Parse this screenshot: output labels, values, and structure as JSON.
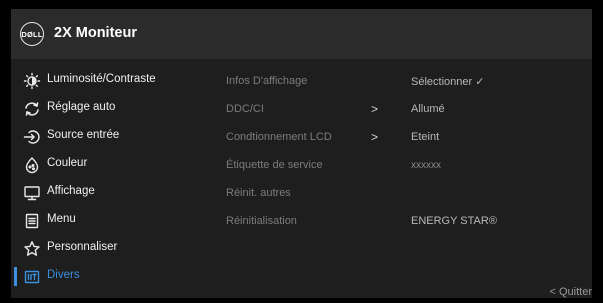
{
  "header": {
    "logo_text": "DØLL",
    "title": "2X Moniteur"
  },
  "sidebar": {
    "items": [
      {
        "label": "Luminosité/Contraste",
        "icon": "brightness-icon"
      },
      {
        "label": "Réglage auto",
        "icon": "auto-adjust-icon"
      },
      {
        "label": "Source entrée",
        "icon": "input-source-icon"
      },
      {
        "label": "Couleur",
        "icon": "color-palette-icon"
      },
      {
        "label": "Affichage",
        "icon": "display-icon"
      },
      {
        "label": "Menu",
        "icon": "menu-icon"
      },
      {
        "label": "Personnaliser",
        "icon": "star-icon"
      },
      {
        "label": "Divers",
        "icon": "others-icon"
      }
    ],
    "active_index": 7
  },
  "submenu": {
    "items": [
      {
        "label": "Infos D'affichage",
        "arrow": "",
        "value": "Sélectionner ✓"
      },
      {
        "label": "DDC/CI",
        "arrow": ">",
        "value": "Allumé"
      },
      {
        "label": "Condtionnement LCD",
        "arrow": ">",
        "value": "Eteint"
      },
      {
        "label": "Étiquette de service",
        "arrow": "",
        "value": "xxxxxx"
      },
      {
        "label": "Réinit. autres",
        "arrow": "",
        "value": ""
      },
      {
        "label": "Réinitialisation",
        "arrow": "",
        "value": "ENERGY STAR®"
      }
    ]
  },
  "footer": {
    "quit_label": "< Quitter"
  },
  "colors": {
    "accent": "#3d8fe0",
    "panel": "#1e1e1e",
    "header": "#2b2b2b"
  }
}
